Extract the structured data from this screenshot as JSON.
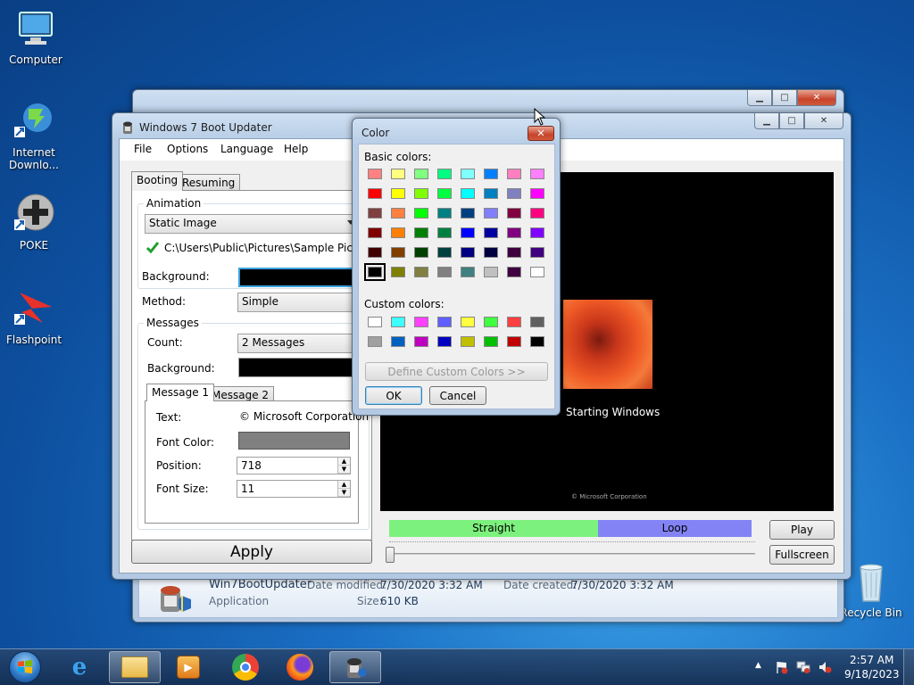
{
  "desktop": {
    "icons": [
      {
        "name": "Computer"
      },
      {
        "name": "Internet Downlo..."
      },
      {
        "name": "POKE"
      },
      {
        "name": "Flashpoint"
      },
      {
        "name": "Recycle Bin"
      }
    ]
  },
  "explorer_details": {
    "file_name": "Win7BootUpdater",
    "date_modified_label": "Date modified:",
    "date_modified": "7/30/2020 3:32 AM",
    "date_created_label": "Date created:",
    "date_created": "7/30/2020 3:32 AM",
    "type": "Application",
    "size_label": "Size:",
    "size": "610 KB"
  },
  "app": {
    "title": "Windows 7 Boot Updater",
    "menu": [
      "File",
      "Options",
      "Language",
      "Help"
    ],
    "tabs": [
      "Booting",
      "Resuming"
    ],
    "animation_group": "Animation",
    "animation_value": "Static Image",
    "image_path": "C:\\Users\\Public\\Pictures\\Sample Pictures\\C",
    "background_label": "Background:",
    "method_label": "Method:",
    "method_value": "Simple",
    "messages_group": "Messages",
    "count_label": "Count:",
    "count_value": "2 Messages",
    "msg_background_label": "Background:",
    "message_tabs": [
      "Message 1",
      "Message 2"
    ],
    "text_label": "Text:",
    "text_value": "© Microsoft Corporation",
    "font_color_label": "Font Color:",
    "position_label": "Position:",
    "position_value": "718",
    "font_size_label": "Font Size:",
    "font_size_value": "11",
    "apply": "Apply",
    "preview_text": "Starting Windows",
    "preview_copyright": "© Microsoft Corporation",
    "timeline_straight": "Straight",
    "timeline_loop": "Loop",
    "play": "Play",
    "fullscreen": "Fullscreen",
    "colors": {
      "straight": "#7df17d",
      "loop": "#8383f5",
      "font_color": "#808080"
    }
  },
  "color_dialog": {
    "title": "Color",
    "basic_label": "Basic colors:",
    "custom_label": "Custom colors:",
    "define_custom": "Define Custom Colors >>",
    "ok": "OK",
    "cancel": "Cancel",
    "basic_colors": [
      "#ff8080",
      "#ffff80",
      "#80ff80",
      "#00ff80",
      "#80ffff",
      "#0080ff",
      "#ff80c0",
      "#ff80ff",
      "#ff0000",
      "#ffff00",
      "#80ff00",
      "#00ff40",
      "#00ffff",
      "#0080c0",
      "#8080c0",
      "#ff00ff",
      "#804040",
      "#ff8040",
      "#00ff00",
      "#008080",
      "#004080",
      "#8080ff",
      "#800040",
      "#ff0080",
      "#800000",
      "#ff8000",
      "#008000",
      "#008040",
      "#0000ff",
      "#0000a0",
      "#800080",
      "#8000ff",
      "#400000",
      "#804000",
      "#004000",
      "#004040",
      "#000080",
      "#000040",
      "#400040",
      "#400080",
      "#000000",
      "#808000",
      "#808040",
      "#808080",
      "#408080",
      "#c0c0c0",
      "#400040",
      "#ffffff"
    ],
    "custom_colors": [
      "#ffffff",
      "#40ffff",
      "#ff40ff",
      "#6060ff",
      "#ffff40",
      "#40ff40",
      "#ff4040",
      "#606060",
      "#a0a0a0",
      "#0060c0",
      "#c000c0",
      "#0000c0",
      "#c0c000",
      "#00c000",
      "#c00000",
      "#000000"
    ],
    "selected_index": 40
  },
  "taskbar": {
    "time": "2:57 AM",
    "date": "9/18/2023",
    "items": [
      "start-orb",
      "internet-explorer",
      "file-explorer",
      "media-player",
      "chrome",
      "firefox",
      "boot-updater"
    ]
  }
}
